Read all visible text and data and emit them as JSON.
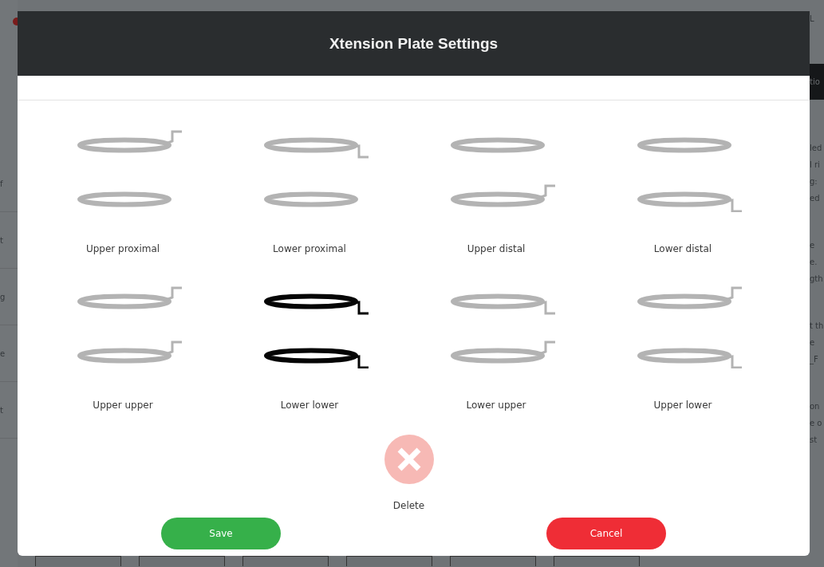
{
  "background_page": {
    "top_right_fragment": "L",
    "band_fragment": "tio",
    "right_paragraphs": [
      [
        "led",
        "l ri",
        "g:",
        "ed"
      ],
      [
        "e",
        "e.",
        "gth"
      ],
      [
        "t th",
        "e",
        "_F"
      ],
      [
        "on",
        "e o",
        "st"
      ]
    ],
    "left_fragments": [
      "f",
      "t",
      "g",
      "e",
      "t"
    ]
  },
  "dialog": {
    "title": "Xtension Plate Settings",
    "options": [
      {
        "label": "Upper proximal",
        "selected": false,
        "rings": [
          {
            "kind": "tabup"
          },
          {
            "kind": "plain"
          }
        ]
      },
      {
        "label": "Lower proximal",
        "selected": false,
        "rings": [
          {
            "kind": "tabdown"
          },
          {
            "kind": "plain"
          }
        ]
      },
      {
        "label": "Upper distal",
        "selected": false,
        "rings": [
          {
            "kind": "plain"
          },
          {
            "kind": "tabup"
          }
        ]
      },
      {
        "label": "Lower distal",
        "selected": false,
        "rings": [
          {
            "kind": "plain"
          },
          {
            "kind": "tabdown"
          }
        ]
      },
      {
        "label": "Upper upper",
        "selected": false,
        "rings": [
          {
            "kind": "tabup"
          },
          {
            "kind": "tabup"
          }
        ]
      },
      {
        "label": "Lower lower",
        "selected": true,
        "rings": [
          {
            "kind": "tabdown"
          },
          {
            "kind": "tabdown"
          }
        ]
      },
      {
        "label": "Lower upper",
        "selected": false,
        "rings": [
          {
            "kind": "tabdown"
          },
          {
            "kind": "tabup"
          }
        ]
      },
      {
        "label": "Upper lower",
        "selected": false,
        "rings": [
          {
            "kind": "tabup"
          },
          {
            "kind": "tabdown"
          }
        ]
      }
    ],
    "delete_label": "Delete",
    "buttons": [
      {
        "label": "Save",
        "kind": "confirm"
      },
      {
        "label": "Cancel",
        "kind": "cancel"
      }
    ]
  }
}
